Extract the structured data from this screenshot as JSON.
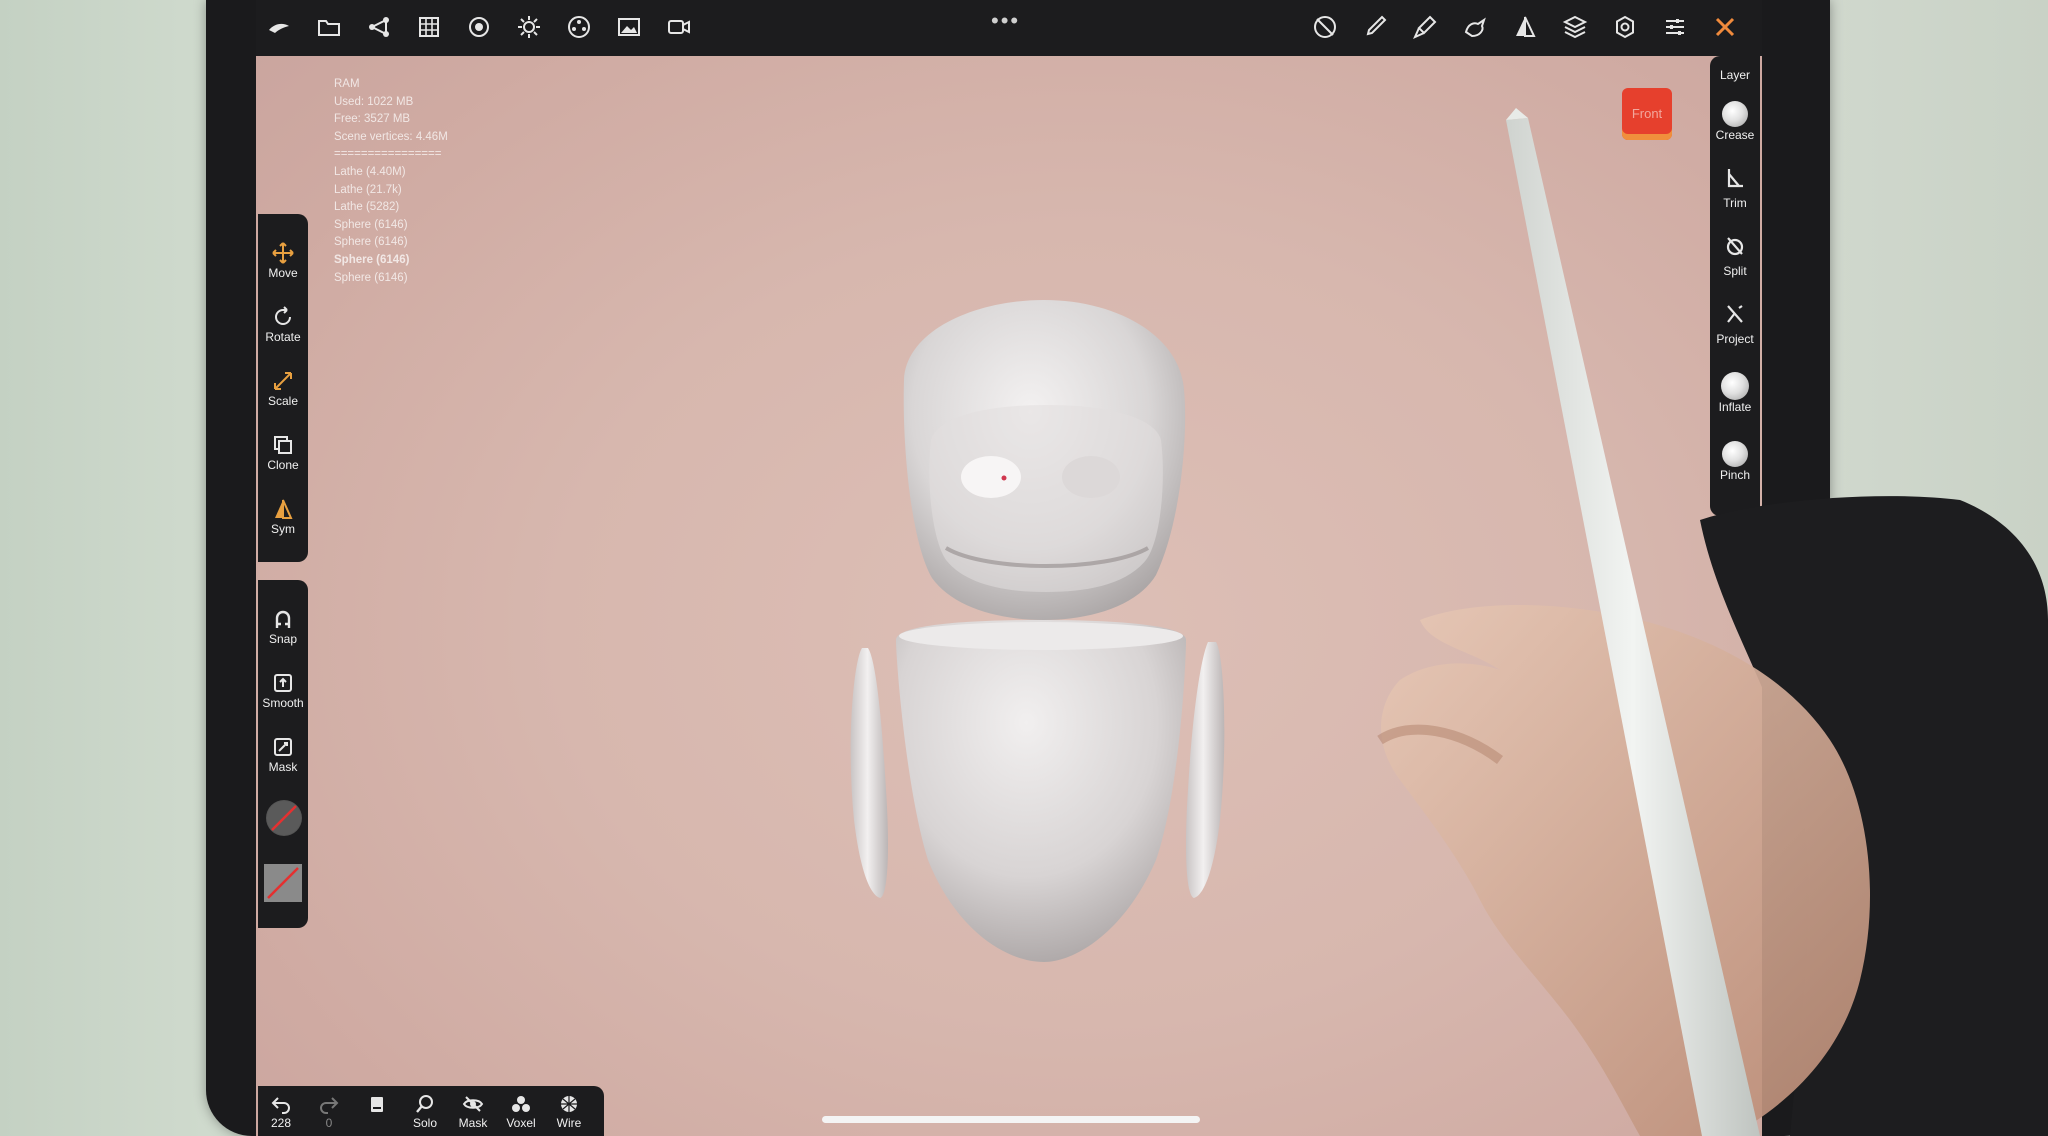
{
  "stats": {
    "lines": [
      "RAM",
      "Used: 1022 MB",
      "Free: 3527 MB",
      "Scene vertices: 4.46M",
      "================",
      "Lathe (4.40M)",
      "Lathe (21.7k)",
      "Lathe (5282)",
      "Sphere (6146)",
      "Sphere (6146)"
    ],
    "selected": "Sphere (6146)",
    "last": "Sphere (6146)"
  },
  "left_tools": {
    "move": "Move",
    "rotate": "Rotate",
    "scale": "Scale",
    "clone": "Clone",
    "sym": "Sym",
    "snap": "Snap",
    "smooth": "Smooth",
    "mask": "Mask"
  },
  "right_tools": {
    "layer": "Layer",
    "crease": "Crease",
    "trim": "Trim",
    "split": "Split",
    "project": "Project",
    "inflate": "Inflate",
    "pinch": "Pinch"
  },
  "view_cube": {
    "label": "Front"
  },
  "bottom": {
    "undo_count": "228",
    "redo_count": "0",
    "solo": "Solo",
    "mask": "Mask",
    "voxel": "Voxel",
    "wire": "Wire"
  },
  "more_dots": "•••",
  "colors": {
    "toolbar": "#1c1c1e",
    "viewport": "#d7b7ae",
    "sym_icon": "#e8a040",
    "front_cube": "#e6402d"
  },
  "icons": {
    "top_left": [
      "logo-icon",
      "folder-icon",
      "scene-tree-icon",
      "grid-icon",
      "material-icon",
      "light-icon",
      "postprocess-icon",
      "background-image-icon",
      "camera-icon"
    ],
    "top_right": [
      "no-brush-icon",
      "brush-icon",
      "paint-icon",
      "smudge-icon",
      "symmetry-icon",
      "layers-icon",
      "settings-icon",
      "sliders-icon",
      "tools-icon"
    ]
  }
}
